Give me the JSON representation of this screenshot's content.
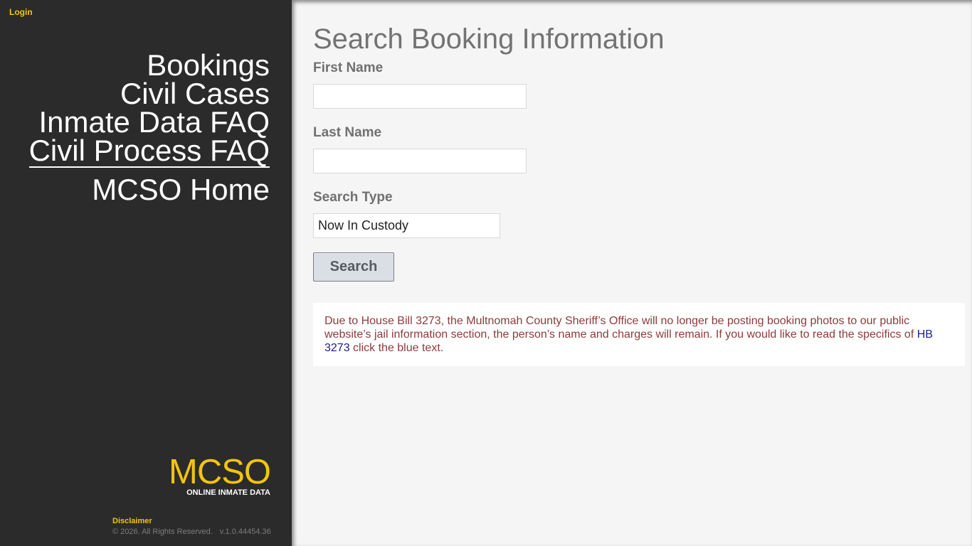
{
  "sidebar": {
    "login_label": "Login",
    "nav": [
      {
        "label": "Bookings"
      },
      {
        "label": "Civil Cases"
      },
      {
        "label": "Inmate Data FAQ"
      },
      {
        "label": "Civil Process FAQ"
      },
      {
        "label": "MCSO Home"
      }
    ],
    "brand": {
      "logo": "MCSO",
      "subtitle": "ONLINE INMATE DATA"
    },
    "footer": {
      "disclaimer": "Disclaimer",
      "copyright": "© 2026. All Rights Reserved.",
      "version": "v.1.0.44454.36"
    }
  },
  "main": {
    "title": "Search Booking Information",
    "first_name_label": "First Name",
    "first_name_value": "",
    "last_name_label": "Last Name",
    "last_name_value": "",
    "search_type_label": "Search Type",
    "search_type_value": "Now In Custody",
    "search_button": "Search",
    "notice": {
      "text_before": "Due to House Bill 3273, the Multnomah County Sheriff’s Office will no longer be posting booking photos to our public website’s jail information section, the person’s name and charges will remain. If you would like to read the specifics of ",
      "link": "HB 3273",
      "text_after": " click the blue text."
    }
  },
  "colors": {
    "sidebar_bg": "#2b2b2b",
    "accent_yellow": "#f2c40f",
    "notice_text": "#8e3a3a",
    "notice_link": "#1b1b8a",
    "main_bg": "#f5f5f5"
  }
}
